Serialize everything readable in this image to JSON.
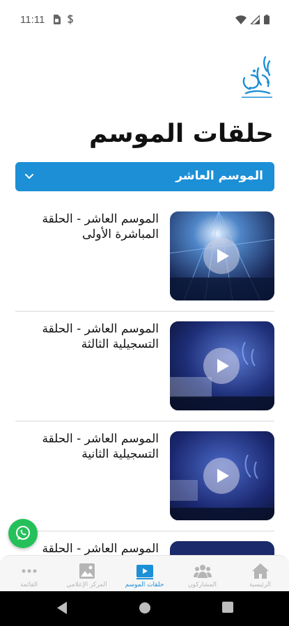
{
  "status_bar": {
    "time": "11:11"
  },
  "header": {
    "title": "حلقات الموسم"
  },
  "season_selector": {
    "selected": "الموسم العاشر"
  },
  "episodes": [
    {
      "title": "الموسم العاشر - الحلقة المباشرة الأولى"
    },
    {
      "title": "الموسم العاشر - الحلقة التسجيلية الثالثة"
    },
    {
      "title": "الموسم العاشر - الحلقة التسجيلية الثانية"
    },
    {
      "title": "الموسم العاشر - الحلقة"
    }
  ],
  "tabs": [
    {
      "label": "القائمة",
      "icon": "more-icon"
    },
    {
      "label": "المركز الإعلامي",
      "icon": "image-icon"
    },
    {
      "label": "حلقات الموسم",
      "icon": "video-icon",
      "active": true
    },
    {
      "label": "المشاركون",
      "icon": "people-icon"
    },
    {
      "label": "الرئيسية",
      "icon": "home-icon"
    }
  ],
  "colors": {
    "accent": "#1c8fd6",
    "whatsapp": "#25c05a"
  }
}
